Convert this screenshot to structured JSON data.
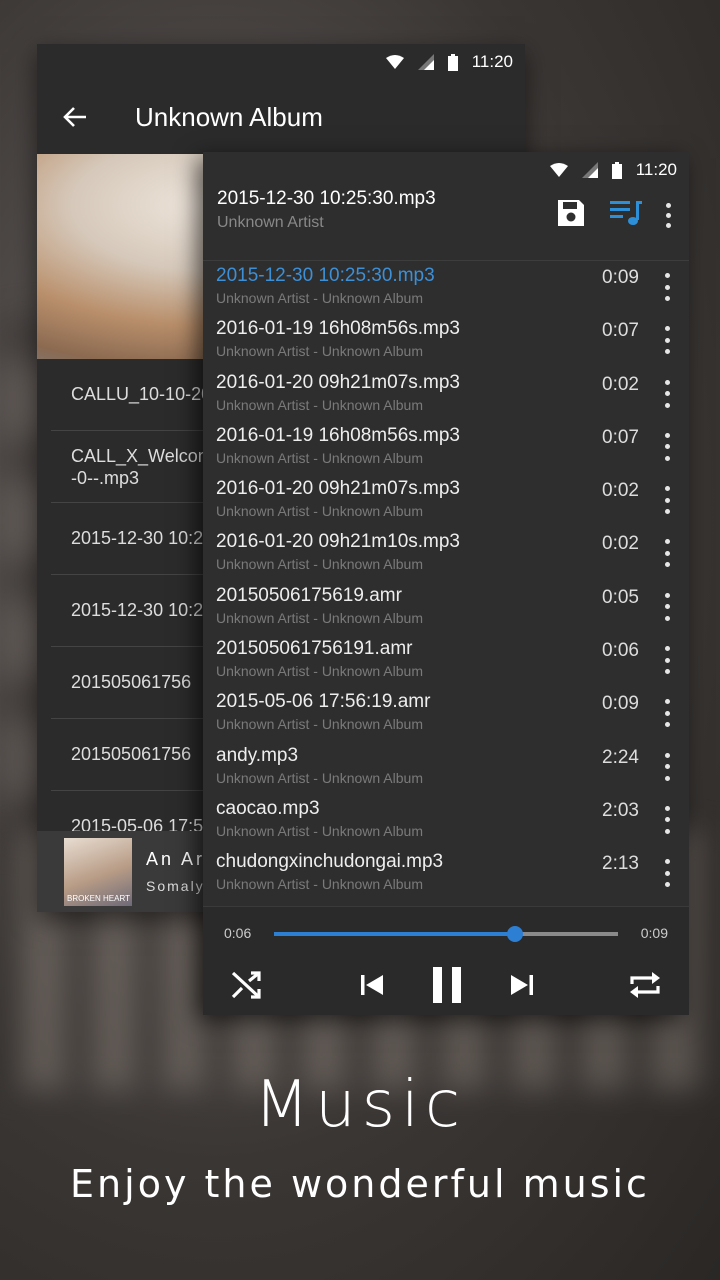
{
  "status_bar": {
    "time": "11:20"
  },
  "album_screen": {
    "title": "Unknown Album",
    "rows": [
      "CALLU_10-10-20",
      "CALL_X_Welcon\n-0--.mp3",
      "2015-12-30 10:2",
      "2015-12-30 10:2",
      "201505061756",
      "201505061756",
      "2015-05-06 17:5"
    ],
    "mini_player": {
      "title": "An Ar",
      "subtitle": "Somaly",
      "art_label": "BROKEN HEART"
    }
  },
  "now_playing": {
    "title": "2015-12-30 10:25:30.mp3",
    "artist": "Unknown Artist",
    "tracks": [
      {
        "title": "2015-12-30 10:25:30.mp3",
        "subtitle": "Unknown Artist - Unknown Album",
        "duration": "0:09",
        "active": true
      },
      {
        "title": "2016-01-19 16h08m56s.mp3",
        "subtitle": "Unknown Artist - Unknown Album",
        "duration": "0:07"
      },
      {
        "title": "2016-01-20 09h21m07s.mp3",
        "subtitle": "Unknown Artist - Unknown Album",
        "duration": "0:02"
      },
      {
        "title": "2016-01-19 16h08m56s.mp3",
        "subtitle": "Unknown Artist - Unknown Album",
        "duration": "0:07"
      },
      {
        "title": "2016-01-20 09h21m07s.mp3",
        "subtitle": "Unknown Artist - Unknown Album",
        "duration": "0:02"
      },
      {
        "title": "2016-01-20 09h21m10s.mp3",
        "subtitle": "Unknown Artist - Unknown Album",
        "duration": "0:02"
      },
      {
        "title": "20150506175619.amr",
        "subtitle": "Unknown Artist - Unknown Album",
        "duration": "0:05"
      },
      {
        "title": "201505061756191.amr",
        "subtitle": "Unknown Artist - Unknown Album",
        "duration": "0:06"
      },
      {
        "title": "2015-05-06 17:56:19.amr",
        "subtitle": "Unknown Artist - Unknown Album",
        "duration": "0:09"
      },
      {
        "title": "andy.mp3",
        "subtitle": "Unknown Artist - Unknown Album",
        "duration": "2:24"
      },
      {
        "title": "caocao.mp3",
        "subtitle": "Unknown Artist - Unknown Album",
        "duration": "2:03"
      },
      {
        "title": "chudongxinchudongai.mp3",
        "subtitle": "Unknown Artist - Unknown Album",
        "duration": "2:13"
      }
    ],
    "player": {
      "elapsed": "0:06",
      "total": "0:09",
      "progress": 0.7
    }
  },
  "colors": {
    "accent": "#2d7fd4",
    "active_text": "#3d8fd6"
  },
  "caption": {
    "title": "Music",
    "subtitle": "Enjoy the wonderful music"
  }
}
